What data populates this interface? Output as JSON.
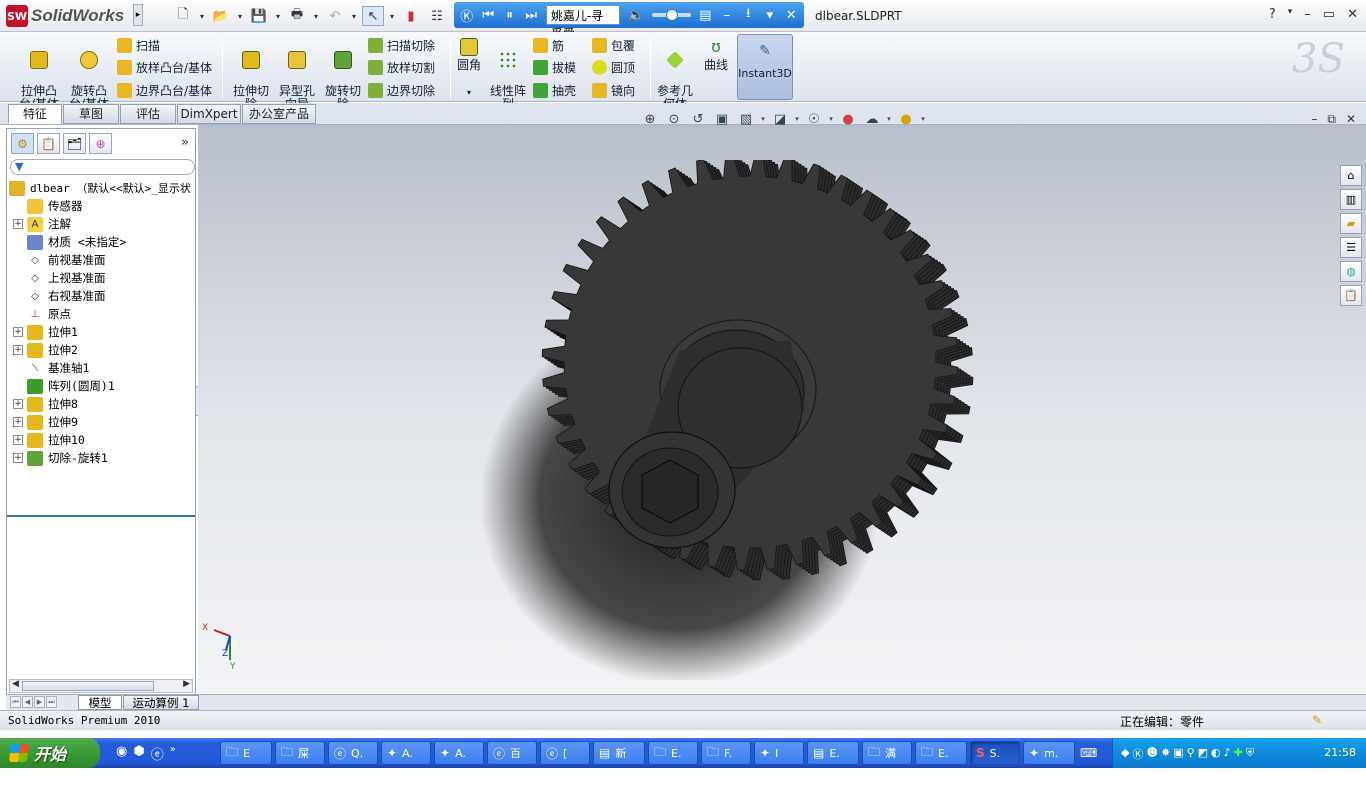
{
  "app": {
    "logo_text": "SolidWorks",
    "document_title": "dlbear.SLDPRT",
    "help_label": "?"
  },
  "player": {
    "song": "姚嘉儿-寻觅爱"
  },
  "command_manager": {
    "extrude_boss": "拉伸凸\n台/基体",
    "revolve_boss": "旋转凸\n台/基体",
    "sweep": "扫描",
    "loft_boss": "放样凸台/基体",
    "boundary_boss": "边界凸台/基体",
    "extrude_cut": "拉伸切\n除",
    "hole_wizard": "异型孔\n向导",
    "revolve_cut": "旋转切\n除",
    "sweep_cut": "扫描切除",
    "loft_cut": "放样切割",
    "boundary_cut": "边界切除",
    "fillet": "圆角",
    "linear_pattern": "线性阵\n列",
    "rib": "筋",
    "draft": "拔模",
    "shell": "抽壳",
    "wrap": "包覆",
    "dome": "圆顶",
    "mirror": "镜向",
    "ref_geometry": "参考几\n何体",
    "curves": "曲线",
    "instant3d": "Instant3D"
  },
  "tabs": [
    "特征",
    "草图",
    "评估",
    "DimXpert",
    "办公室产品"
  ],
  "feature_tree": {
    "root": "dlbear （默认<<默认>_显示状",
    "items": [
      {
        "label": "传感器",
        "expandable": false,
        "icon": "sensor-icon"
      },
      {
        "label": "注解",
        "expandable": true,
        "icon": "annotation-icon"
      },
      {
        "label": "材质 <未指定>",
        "expandable": false,
        "icon": "material-icon"
      },
      {
        "label": "前视基准面",
        "expandable": false,
        "icon": "plane-icon"
      },
      {
        "label": "上视基准面",
        "expandable": false,
        "icon": "plane-icon"
      },
      {
        "label": "右视基准面",
        "expandable": false,
        "icon": "plane-icon"
      },
      {
        "label": "原点",
        "expandable": false,
        "icon": "origin-icon"
      },
      {
        "label": "拉伸1",
        "expandable": true,
        "icon": "extrude-icon"
      },
      {
        "label": "拉伸2",
        "expandable": true,
        "icon": "extrude-icon"
      },
      {
        "label": "基准轴1",
        "expandable": false,
        "icon": "axis-icon"
      },
      {
        "label": "阵列(圆周)1",
        "expandable": false,
        "icon": "pattern-icon"
      },
      {
        "label": "拉伸8",
        "expandable": true,
        "icon": "extrude-icon"
      },
      {
        "label": "拉伸9",
        "expandable": true,
        "icon": "extrude-icon"
      },
      {
        "label": "拉伸10",
        "expandable": true,
        "icon": "extrude-icon"
      },
      {
        "label": "切除-旋转1",
        "expandable": true,
        "icon": "revolve-cut-icon"
      }
    ]
  },
  "model_tabs": [
    "模型",
    "运动算例 1"
  ],
  "status": {
    "left": "SolidWorks Premium 2010",
    "right": "正在编辑：零件"
  },
  "triad": {
    "x": "X",
    "y": "Y",
    "z": "Z"
  },
  "taskbar": {
    "start_label": "开始",
    "tasks": [
      {
        "icon": "folder-icon",
        "label": "E"
      },
      {
        "icon": "folder-icon",
        "label": "屎"
      },
      {
        "icon": "ie-icon",
        "label": "Q."
      },
      {
        "icon": "app-icon",
        "label": "A."
      },
      {
        "icon": "app-icon",
        "label": "A."
      },
      {
        "icon": "ie-icon",
        "label": "百"
      },
      {
        "icon": "ie-icon",
        "label": "["
      },
      {
        "icon": "doc-icon",
        "label": "新"
      },
      {
        "icon": "folder-icon",
        "label": "E."
      },
      {
        "icon": "folder-icon",
        "label": "F."
      },
      {
        "icon": "app-icon",
        "label": "I"
      },
      {
        "icon": "doc-icon",
        "label": "E."
      },
      {
        "icon": "folder-icon",
        "label": "满"
      },
      {
        "icon": "folder-icon",
        "label": "E."
      },
      {
        "icon": "solidworks-icon",
        "label": "S."
      },
      {
        "icon": "app-icon",
        "label": "m."
      }
    ],
    "clock": "21:58"
  }
}
